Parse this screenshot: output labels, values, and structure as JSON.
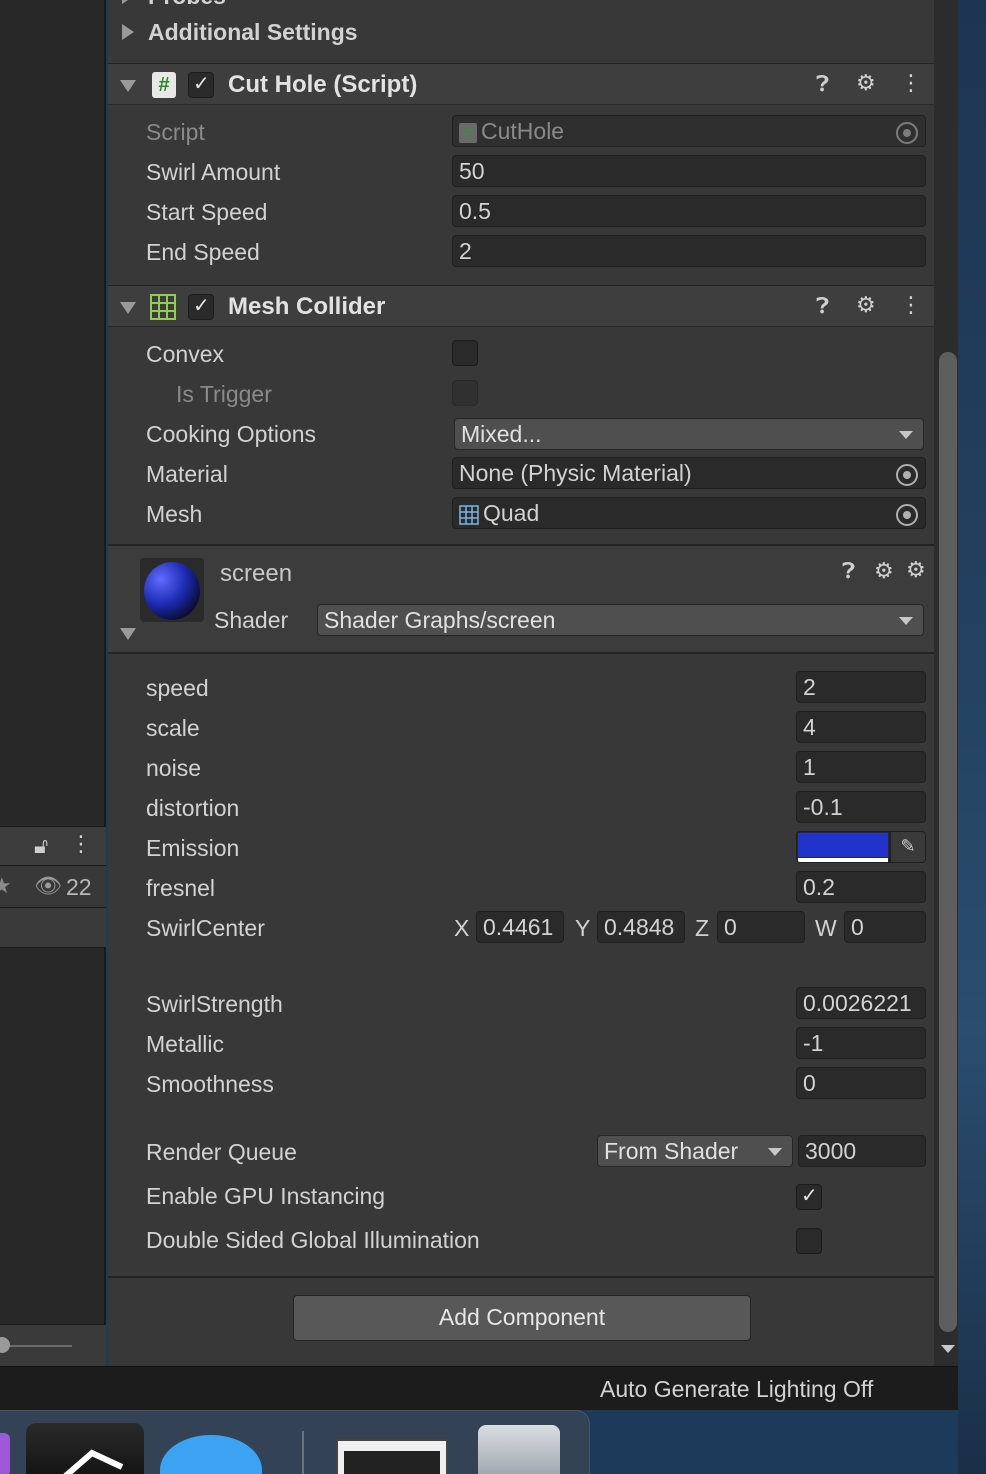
{
  "sections": {
    "probes_label": "Probes",
    "additional_settings": "Additional Settings"
  },
  "cut_hole": {
    "title": "Cut Hole (Script)",
    "script_label": "Script",
    "script_value": "CutHole",
    "swirl_amount_label": "Swirl Amount",
    "swirl_amount_value": "50",
    "start_speed_label": "Start Speed",
    "start_speed_value": "0.5",
    "end_speed_label": "End Speed",
    "end_speed_value": "2"
  },
  "mesh_collider": {
    "title": "Mesh Collider",
    "convex_label": "Convex",
    "is_trigger_label": "Is Trigger",
    "cooking_options_label": "Cooking Options",
    "cooking_options_value": "Mixed...",
    "material_label": "Material",
    "material_value": "None (Physic Material)",
    "mesh_label": "Mesh",
    "mesh_value": "Quad"
  },
  "material": {
    "name": "screen",
    "shader_label": "Shader",
    "shader_value": "Shader Graphs/screen",
    "properties": [
      {
        "label": "speed",
        "value": "2"
      },
      {
        "label": "scale",
        "value": "4"
      },
      {
        "label": "noise",
        "value": "1"
      },
      {
        "label": "distortion",
        "value": "-0.1"
      }
    ],
    "emission_label": "Emission",
    "emission_color": "#2233cc",
    "fresnel_label": "fresnel",
    "fresnel_value": "0.2",
    "swirl_center_label": "SwirlCenter",
    "swirl_center": {
      "x_label": "X",
      "x_value": "0.4461",
      "y_label": "Y",
      "y_value": "0.4848",
      "z_label": "Z",
      "z_value": "0",
      "w_label": "W",
      "w_value": "0"
    },
    "swirl_strength_label": "SwirlStrength",
    "swirl_strength_value": "0.0026221",
    "metallic_label": "Metallic",
    "metallic_value": "-1",
    "smoothness_label": "Smoothness",
    "smoothness_value": "0",
    "render_queue_label": "Render Queue",
    "render_queue_mode": "From Shader",
    "render_queue_value": "3000",
    "gpu_instancing_label": "Enable GPU Instancing",
    "gpu_instancing_checked": true,
    "double_sided_gi_label": "Double Sided Global Illumination",
    "double_sided_gi_checked": false
  },
  "add_component_label": "Add Component",
  "left_panel": {
    "hidden_count": "22"
  },
  "status_bar": {
    "text": "Auto Generate Lighting Off"
  }
}
